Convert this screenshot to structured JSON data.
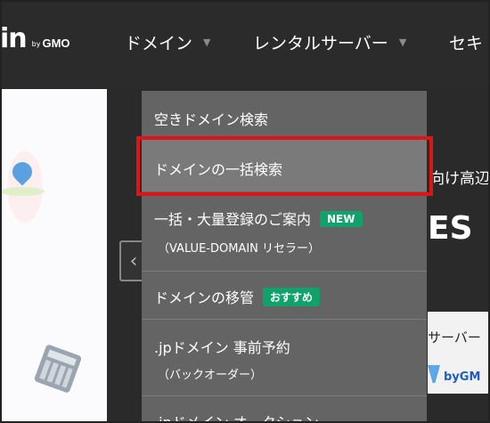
{
  "header": {
    "logo_main": "in",
    "logo_by": "by",
    "logo_gmo": "GMO",
    "nav": [
      {
        "label": "ドメイン",
        "caret": "▼"
      },
      {
        "label": "レンタルサーバー",
        "caret": "▼"
      },
      {
        "label": "セキ"
      }
    ]
  },
  "dropdown": {
    "items": [
      {
        "label": "空きドメイン検索"
      },
      {
        "label": "ドメインの一括検索"
      },
      {
        "label": "一括・大量登録のご案内",
        "badge": "NEW",
        "sub": "（VALUE-DOMAIN リセラー）"
      },
      {
        "label": "ドメインの移管",
        "badge": "おすすめ"
      },
      {
        "label": ".jpドメイン 事前予約",
        "sub": "（バックオーダー）"
      },
      {
        "label": ".jpドメイン オークション"
      }
    ]
  },
  "background": {
    "right_text": "向け高辺",
    "big_text": "ES",
    "card_text": "サーバー",
    "card_brand": "byGM",
    "arrow": "‹"
  },
  "colors": {
    "header_bg": "#2b2b2b",
    "dropdown_bg": "#646464",
    "hover_bg": "#7a7a7a",
    "badge_green": "#0fa36b",
    "highlight_red": "#e01414"
  }
}
